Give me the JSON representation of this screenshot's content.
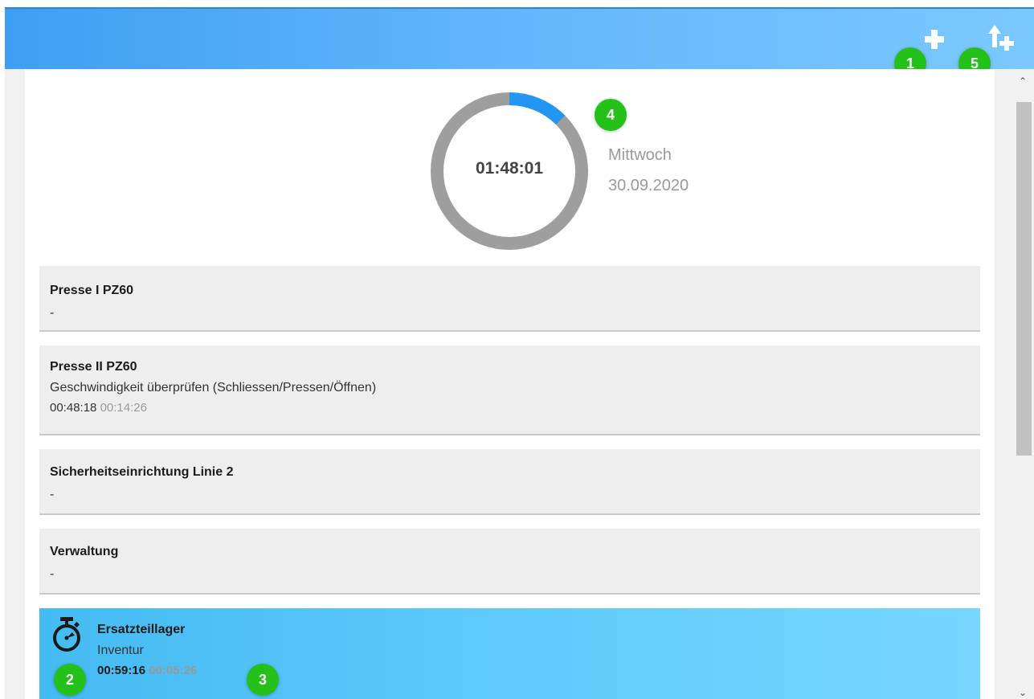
{
  "header": {
    "add_icon": "plus-icon",
    "upload_icon": "upload-plus-icon",
    "badges": [
      "1",
      "5"
    ]
  },
  "summary": {
    "total_time": "01:48:01",
    "progress_fraction": 0.125,
    "badge": "4",
    "weekday": "Mittwoch",
    "date": "30.09.2020"
  },
  "entries": [
    {
      "title": "Presse I PZ60",
      "subtitle": "-"
    },
    {
      "title": "Presse II PZ60",
      "subtitle": "Geschwindigkeit überprüfen (Schliessen/Pressen/Öffnen)",
      "time_total": "00:48:18",
      "time_current": "00:14:26"
    },
    {
      "title": "Sicherheitseinrichtung Linie 2",
      "subtitle": "-"
    },
    {
      "title": "Verwaltung",
      "subtitle": "-"
    },
    {
      "title": "Ersatzteillager",
      "subtitle": "Inventur",
      "time_total": "00:59:16",
      "time_current": "00:05:26",
      "active": true,
      "icon": "stopwatch-icon",
      "badges": [
        "2",
        "3"
      ]
    }
  ],
  "colors": {
    "accent": "#2196f3",
    "ring_track": "#9e9e9e",
    "badge": "#23c11a",
    "header_start": "#3e9ff2",
    "header_end": "#7cc8ff"
  }
}
